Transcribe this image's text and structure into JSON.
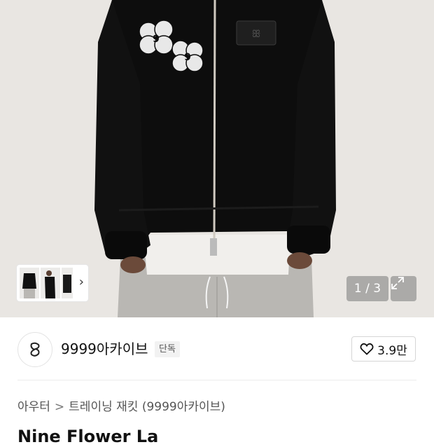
{
  "gallery": {
    "counter": "1 / 3",
    "next_label": "›"
  },
  "brand": {
    "name": "9999아카이브",
    "badge": "단독",
    "likes": "3.9만"
  },
  "breadcrumb": {
    "category": "아우터",
    "separator": ">",
    "subcategory": "트레이닝 재킷 (9999아카이브)"
  },
  "product": {
    "title": "Nine Flower La"
  },
  "colors": {
    "jacket": "#0d0d0d",
    "background": "#e9e6e2",
    "pants": "#b9b7b3"
  }
}
